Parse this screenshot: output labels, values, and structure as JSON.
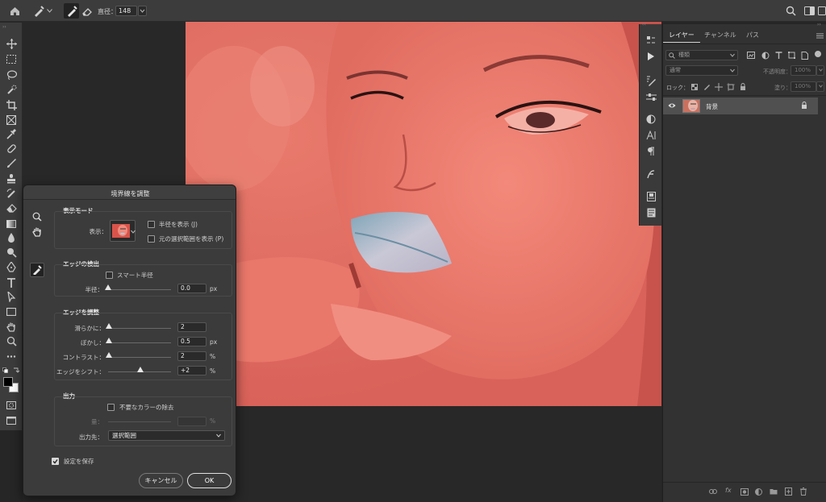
{
  "top_bar": {
    "size_label": "直径：",
    "size_value": "148"
  },
  "layers_panel": {
    "tabs": [
      "レイヤー",
      "チャンネル",
      "パス"
    ],
    "search_kind": "種類",
    "blend_mode": "通常",
    "opacity_label": "不透明度：",
    "opacity_value": "100%",
    "lock_label": "ロック：",
    "fill_label": "塗り：",
    "fill_value": "100%",
    "layer": {
      "name": "背景"
    }
  },
  "dialog": {
    "title": "境界線を調整",
    "view_mode": {
      "heading": "表示モード",
      "view_label": "表示：",
      "show_radius": "半径を表示 (J)",
      "show_original": "元の選択範囲を表示 (P)"
    },
    "edge_detection": {
      "heading": "エッジの検出",
      "smart_radius": "スマート半径",
      "radius_label": "半径：",
      "radius_value": "0.0",
      "radius_unit": "px"
    },
    "adjust_edge": {
      "heading": "エッジを調整",
      "smooth_label": "滑らかに：",
      "smooth_value": "2",
      "feather_label": "ぼかし：",
      "feather_value": "0.5",
      "feather_unit": "px",
      "contrast_label": "コントラスト：",
      "contrast_value": "2",
      "contrast_unit": "%",
      "shift_label": "エッジをシフト：",
      "shift_value": "+2",
      "shift_unit": "%"
    },
    "output": {
      "heading": "出力",
      "decontaminate": "不要なカラーの除去",
      "amount_label": "量：",
      "amount_unit": "%",
      "output_to_label": "出力先：",
      "output_to_value": "選択範囲"
    },
    "remember_settings": "設定を保存",
    "cancel_button": "キャンセル",
    "ok_button": "OK"
  }
}
